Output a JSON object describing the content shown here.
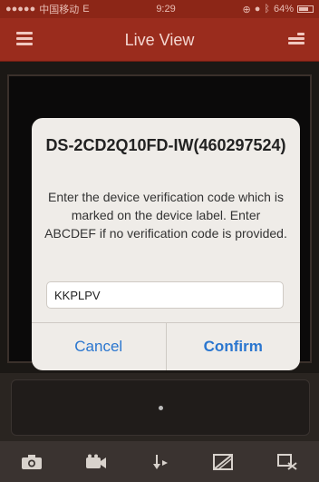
{
  "status_bar": {
    "carrier": "中国移动",
    "network": "E",
    "time": "9:29",
    "battery": "64%"
  },
  "nav": {
    "title": "Live View"
  },
  "dialog": {
    "title": "DS-2CD2Q10FD-IW(460297524)",
    "message": "Enter the device verification code which is marked on the device label. Enter ABCDEF if no verification code is provided.",
    "input_value": "KKPLPV",
    "cancel_label": "Cancel",
    "confirm_label": "Confirm"
  },
  "toolbar": {
    "icons": [
      "camera-icon",
      "video-record-icon",
      "ptz-control-icon",
      "image-quality-icon",
      "close-all-icon"
    ]
  },
  "colors": {
    "nav_bar": "#9a2c1d",
    "button_text": "#2a76cf",
    "dialog_bg": "#efece8"
  }
}
